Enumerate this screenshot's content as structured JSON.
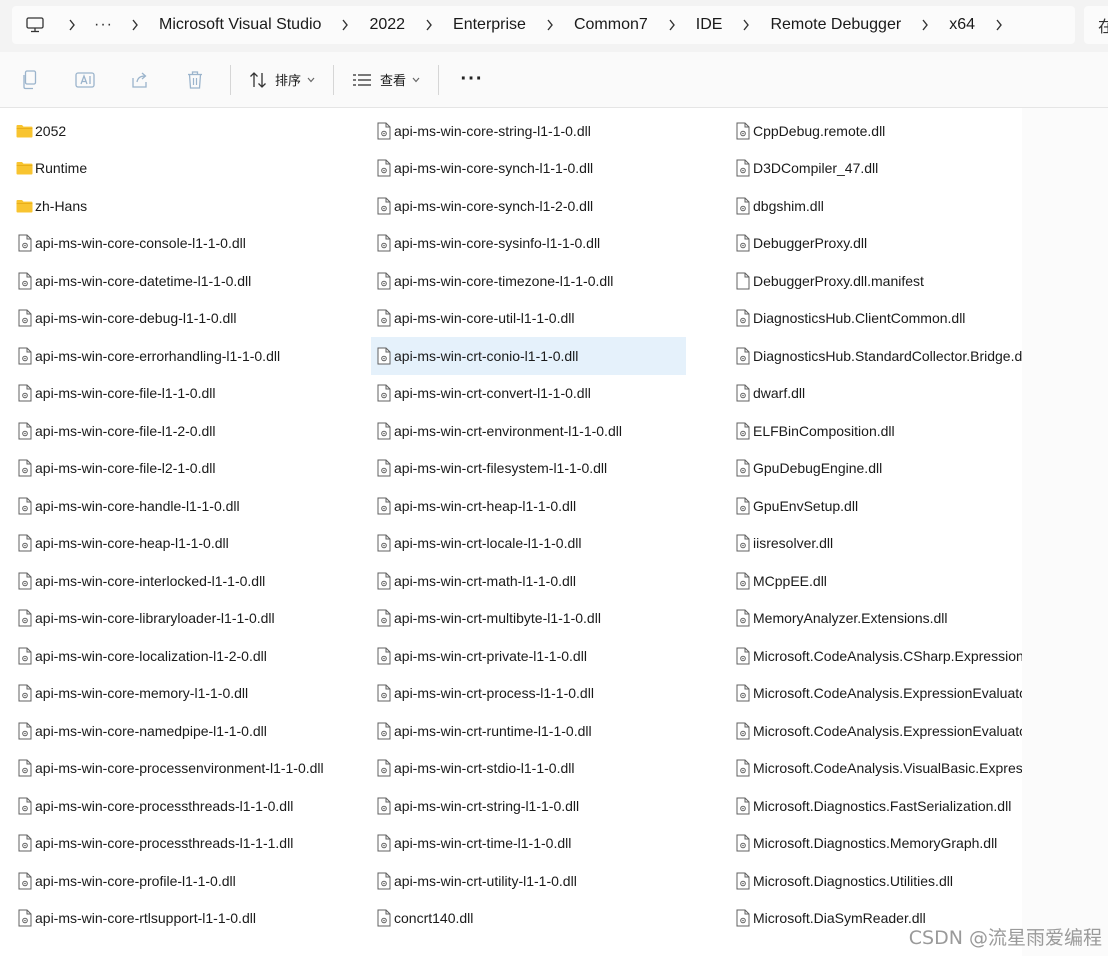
{
  "address": {
    "breadcrumbs": [
      "Microsoft Visual Studio",
      "2022",
      "Enterprise",
      "Common7",
      "IDE",
      "Remote Debugger",
      "x64"
    ],
    "more_label": "···",
    "side_text": "在"
  },
  "toolbar": {
    "sort_label": "排序",
    "view_label": "查看",
    "more_label": "···"
  },
  "columns": [
    [
      {
        "name": "2052",
        "type": "folder"
      },
      {
        "name": "Runtime",
        "type": "folder"
      },
      {
        "name": "zh-Hans",
        "type": "folder"
      },
      {
        "name": "api-ms-win-core-console-l1-1-0.dll",
        "type": "dll"
      },
      {
        "name": "api-ms-win-core-datetime-l1-1-0.dll",
        "type": "dll"
      },
      {
        "name": "api-ms-win-core-debug-l1-1-0.dll",
        "type": "dll"
      },
      {
        "name": "api-ms-win-core-errorhandling-l1-1-0.dll",
        "type": "dll"
      },
      {
        "name": "api-ms-win-core-file-l1-1-0.dll",
        "type": "dll"
      },
      {
        "name": "api-ms-win-core-file-l1-2-0.dll",
        "type": "dll"
      },
      {
        "name": "api-ms-win-core-file-l2-1-0.dll",
        "type": "dll"
      },
      {
        "name": "api-ms-win-core-handle-l1-1-0.dll",
        "type": "dll"
      },
      {
        "name": "api-ms-win-core-heap-l1-1-0.dll",
        "type": "dll"
      },
      {
        "name": "api-ms-win-core-interlocked-l1-1-0.dll",
        "type": "dll"
      },
      {
        "name": "api-ms-win-core-libraryloader-l1-1-0.dll",
        "type": "dll"
      },
      {
        "name": "api-ms-win-core-localization-l1-2-0.dll",
        "type": "dll"
      },
      {
        "name": "api-ms-win-core-memory-l1-1-0.dll",
        "type": "dll"
      },
      {
        "name": "api-ms-win-core-namedpipe-l1-1-0.dll",
        "type": "dll"
      },
      {
        "name": "api-ms-win-core-processenvironment-l1-1-0.dll",
        "type": "dll"
      },
      {
        "name": "api-ms-win-core-processthreads-l1-1-0.dll",
        "type": "dll"
      },
      {
        "name": "api-ms-win-core-processthreads-l1-1-1.dll",
        "type": "dll"
      },
      {
        "name": "api-ms-win-core-profile-l1-1-0.dll",
        "type": "dll"
      },
      {
        "name": "api-ms-win-core-rtlsupport-l1-1-0.dll",
        "type": "dll"
      }
    ],
    [
      {
        "name": "api-ms-win-core-string-l1-1-0.dll",
        "type": "dll"
      },
      {
        "name": "api-ms-win-core-synch-l1-1-0.dll",
        "type": "dll"
      },
      {
        "name": "api-ms-win-core-synch-l1-2-0.dll",
        "type": "dll"
      },
      {
        "name": "api-ms-win-core-sysinfo-l1-1-0.dll",
        "type": "dll"
      },
      {
        "name": "api-ms-win-core-timezone-l1-1-0.dll",
        "type": "dll"
      },
      {
        "name": "api-ms-win-core-util-l1-1-0.dll",
        "type": "dll"
      },
      {
        "name": "api-ms-win-crt-conio-l1-1-0.dll",
        "type": "dll",
        "selected": true
      },
      {
        "name": "api-ms-win-crt-convert-l1-1-0.dll",
        "type": "dll"
      },
      {
        "name": "api-ms-win-crt-environment-l1-1-0.dll",
        "type": "dll"
      },
      {
        "name": "api-ms-win-crt-filesystem-l1-1-0.dll",
        "type": "dll"
      },
      {
        "name": "api-ms-win-crt-heap-l1-1-0.dll",
        "type": "dll"
      },
      {
        "name": "api-ms-win-crt-locale-l1-1-0.dll",
        "type": "dll"
      },
      {
        "name": "api-ms-win-crt-math-l1-1-0.dll",
        "type": "dll"
      },
      {
        "name": "api-ms-win-crt-multibyte-l1-1-0.dll",
        "type": "dll"
      },
      {
        "name": "api-ms-win-crt-private-l1-1-0.dll",
        "type": "dll"
      },
      {
        "name": "api-ms-win-crt-process-l1-1-0.dll",
        "type": "dll"
      },
      {
        "name": "api-ms-win-crt-runtime-l1-1-0.dll",
        "type": "dll"
      },
      {
        "name": "api-ms-win-crt-stdio-l1-1-0.dll",
        "type": "dll"
      },
      {
        "name": "api-ms-win-crt-string-l1-1-0.dll",
        "type": "dll"
      },
      {
        "name": "api-ms-win-crt-time-l1-1-0.dll",
        "type": "dll"
      },
      {
        "name": "api-ms-win-crt-utility-l1-1-0.dll",
        "type": "dll"
      },
      {
        "name": "concrt140.dll",
        "type": "dll"
      }
    ],
    [
      {
        "name": "CppDebug.remote.dll",
        "type": "dll"
      },
      {
        "name": "D3DCompiler_47.dll",
        "type": "dll"
      },
      {
        "name": "dbgshim.dll",
        "type": "dll"
      },
      {
        "name": "DebuggerProxy.dll",
        "type": "dll"
      },
      {
        "name": "DebuggerProxy.dll.manifest",
        "type": "file"
      },
      {
        "name": "DiagnosticsHub.ClientCommon.dll",
        "type": "dll"
      },
      {
        "name": "DiagnosticsHub.StandardCollector.Bridge.dll",
        "type": "dll"
      },
      {
        "name": "dwarf.dll",
        "type": "dll"
      },
      {
        "name": "ELFBinComposition.dll",
        "type": "dll"
      },
      {
        "name": "GpuDebugEngine.dll",
        "type": "dll"
      },
      {
        "name": "GpuEnvSetup.dll",
        "type": "dll"
      },
      {
        "name": "iisresolver.dll",
        "type": "dll"
      },
      {
        "name": "MCppEE.dll",
        "type": "dll"
      },
      {
        "name": "MemoryAnalyzer.Extensions.dll",
        "type": "dll"
      },
      {
        "name": "Microsoft.CodeAnalysis.CSharp.ExpressionEvaluator.dll",
        "type": "dll"
      },
      {
        "name": "Microsoft.CodeAnalysis.ExpressionEvaluator.dll",
        "type": "dll"
      },
      {
        "name": "Microsoft.CodeAnalysis.ExpressionEvaluator.FunctionResolver.dll",
        "type": "dll"
      },
      {
        "name": "Microsoft.CodeAnalysis.VisualBasic.ExpressionEvaluator.dll",
        "type": "dll"
      },
      {
        "name": "Microsoft.Diagnostics.FastSerialization.dll",
        "type": "dll"
      },
      {
        "name": "Microsoft.Diagnostics.MemoryGraph.dll",
        "type": "dll"
      },
      {
        "name": "Microsoft.Diagnostics.Utilities.dll",
        "type": "dll"
      },
      {
        "name": "Microsoft.DiaSymReader.dll",
        "type": "dll"
      }
    ]
  ],
  "watermark": "CSDN @流星雨爱编程",
  "colors": {
    "folder": "#f8c430",
    "selection": "#e5f1fb",
    "toolbar_disabled_icon": "#9bb4cc"
  }
}
